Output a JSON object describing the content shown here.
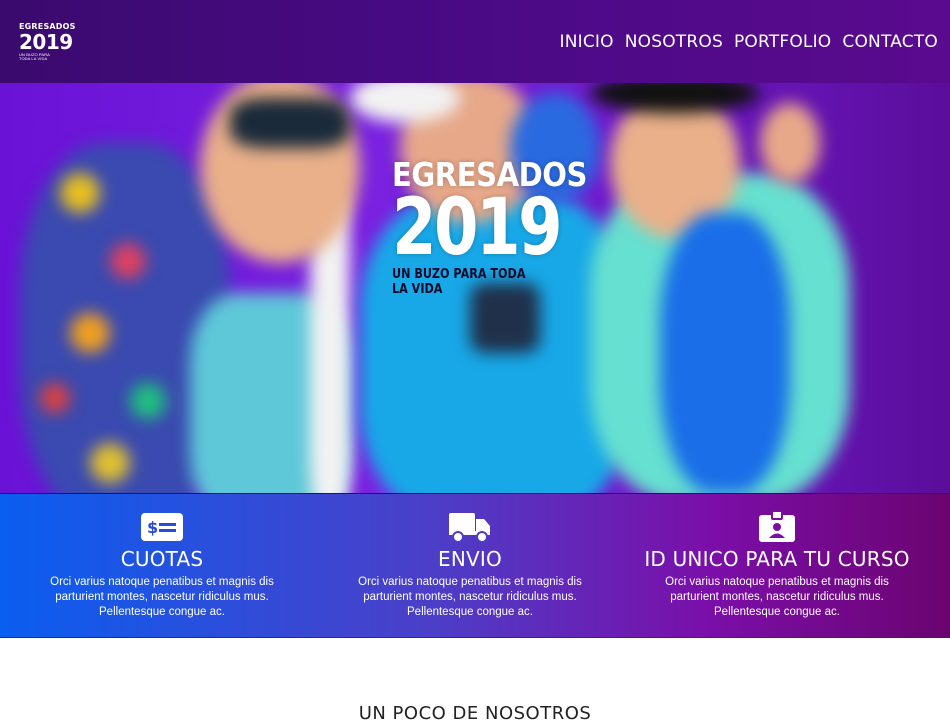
{
  "header": {
    "logo_line1": "EGRESADOS",
    "logo_line2": "2019",
    "logo_line3": "UN BUZO PARA TODA LA VIDA",
    "nav": [
      {
        "label": "INICIO"
      },
      {
        "label": "NOSOTROS"
      },
      {
        "label": "PORTFOLIO"
      },
      {
        "label": "CONTACTO"
      }
    ]
  },
  "hero": {
    "title_line1": "EGRESADOS",
    "title_line2": "2019",
    "tagline": "UN BUZO PARA TODA LA VIDA"
  },
  "features": [
    {
      "icon": "money-bill-icon",
      "title": "CUOTAS",
      "desc": "Orci varius natoque penatibus et magnis dis parturient montes, nascetur ridiculus mus. Pellentesque congue ac."
    },
    {
      "icon": "truck-icon",
      "title": "ENVIO",
      "desc": "Orci varius natoque penatibus et magnis dis parturient montes, nascetur ridiculus mus. Pellentesque congue ac."
    },
    {
      "icon": "id-badge-icon",
      "title": "ID UNICO PARA TU CURSO",
      "desc": "Orci varius natoque penatibus et magnis dis parturient montes, nascetur ridiculus mus. Pellentesque congue ac."
    }
  ],
  "about": {
    "title": "UN POCO DE NOSOTROS"
  },
  "colors": {
    "header_bg": "#4a0a86",
    "hero_bg": "#7a22e0",
    "features_left": "#0a5ef0",
    "features_right": "#6b0470"
  }
}
